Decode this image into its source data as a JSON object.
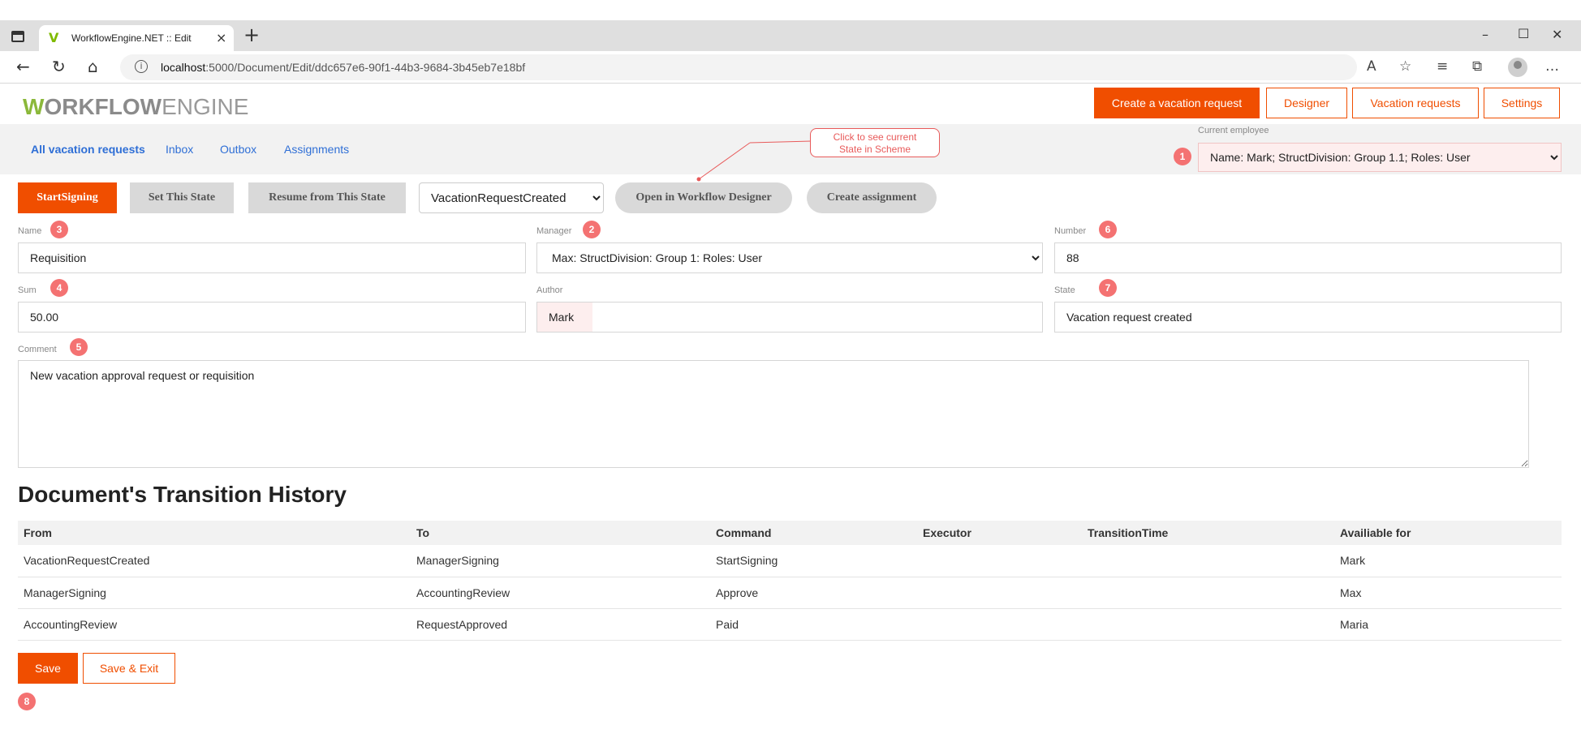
{
  "browser": {
    "tab_title": "WorkflowEngine.NET :: Edit",
    "url_host": "localhost",
    "url_path": ":5000/Document/Edit/ddc657e6-90f1-44b3-9684-3b45eb7e18bf"
  },
  "header": {
    "logo_w": "W",
    "logo_a": "ORKFLOW",
    "logo_b": "ENGINE",
    "buttons": {
      "create": "Create a vacation request",
      "designer": "Designer",
      "vacation_requests": "Vacation requests",
      "settings": "Settings"
    }
  },
  "subnav": {
    "links": [
      "All vacation requests",
      "Inbox",
      "Outbox",
      "Assignments"
    ]
  },
  "callout": {
    "line1": "Click to see current",
    "line2": "State in Scheme"
  },
  "employee": {
    "label": "Current employee",
    "selected": "Name: Mark; StructDivision: Group 1.1; Roles: User"
  },
  "markers": [
    "1",
    "2",
    "3",
    "4",
    "5",
    "6",
    "7",
    "8"
  ],
  "actions": {
    "start_signing": "StartSigning",
    "set_state": "Set This State",
    "resume": "Resume from This State",
    "state_selected": "VacationRequestCreated",
    "open_designer": "Open in Workflow Designer",
    "create_assignment": "Create assignment"
  },
  "form": {
    "name_label": "Name",
    "name_value": "Requisition",
    "manager_label": "Manager",
    "manager_value": "Max: StructDivision: Group 1: Roles: User",
    "number_label": "Number",
    "number_value": "88",
    "sum_label": "Sum",
    "sum_value": "50.00",
    "author_label": "Author",
    "author_value": "Mark",
    "state_label": "State",
    "state_value": "Vacation request created",
    "comment_label": "Comment",
    "comment_value": "New vacation approval request or requisition"
  },
  "history": {
    "title": "Document's Transition History",
    "columns": [
      "From",
      "To",
      "Command",
      "Executor",
      "TransitionTime",
      "Availiable for"
    ],
    "rows": [
      [
        "VacationRequestCreated",
        "ManagerSigning",
        "StartSigning",
        "",
        "",
        "Mark"
      ],
      [
        "ManagerSigning",
        "AccountingReview",
        "Approve",
        "",
        "",
        "Max"
      ],
      [
        "AccountingReview",
        "RequestApproved",
        "Paid",
        "",
        "",
        "Maria"
      ]
    ]
  },
  "footer": {
    "save": "Save",
    "save_exit": "Save & Exit"
  },
  "colors": {
    "accent": "#f04e00",
    "marker": "#f47272",
    "link": "#2f6fd6",
    "logo_green": "#8bb83a"
  }
}
